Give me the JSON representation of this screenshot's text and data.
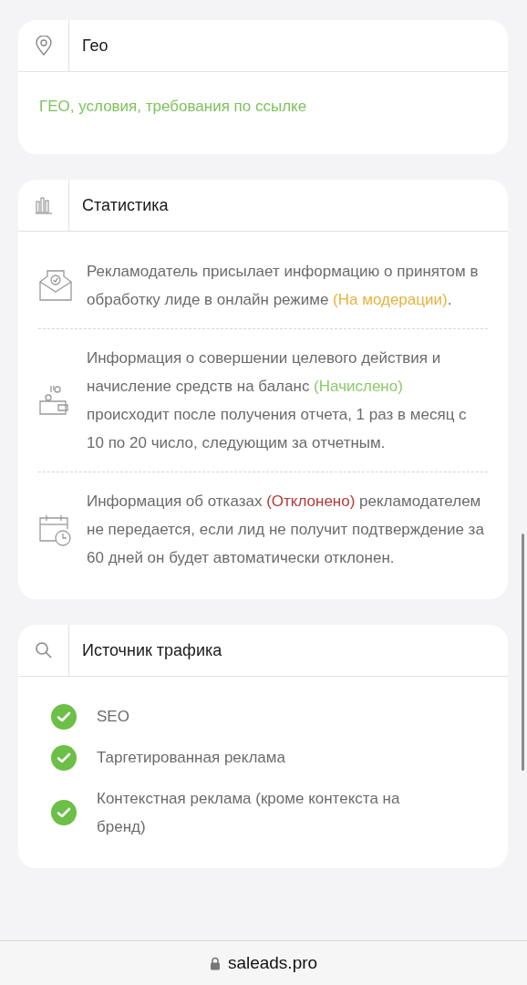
{
  "geo": {
    "title": "Гео",
    "link": "ГЕО, условия, требования по ссылке"
  },
  "statistics": {
    "title": "Статистика",
    "items": [
      {
        "kind": "envelope",
        "text_before": "Рекламодатель присылает информацию о принятом в обработку лиде в онлайн режиме ",
        "status": "(На модерации)",
        "color": "#e8b23a",
        "text_after": "."
      },
      {
        "kind": "wallet",
        "text_before": "Информация о совершении целевого действия и начисление средств на баланс ",
        "status": "(Начислено)",
        "color": "#8cc96a",
        "text_after": " происходит после получения отчета, 1 раз в месяц с 10 по 20 число, следующим за отчетным."
      },
      {
        "kind": "calendar",
        "text_before": "Информация об отказах ",
        "status": "(Отклонено)",
        "color": "#b33a3a",
        "text_after": " рекламодателем не передается, если лид не получит подтверждение за 60 дней он будет автоматически отклонен."
      }
    ]
  },
  "traffic_sources": {
    "title": "Источник трафика",
    "items": [
      {
        "label": "SEO",
        "checked": true
      },
      {
        "label": "Таргетированная реклама",
        "checked": true
      },
      {
        "label": "Контекстная реклама (кроме контекста на бренд)",
        "checked": true
      }
    ]
  },
  "address_bar": {
    "url": "saleads.pro"
  }
}
